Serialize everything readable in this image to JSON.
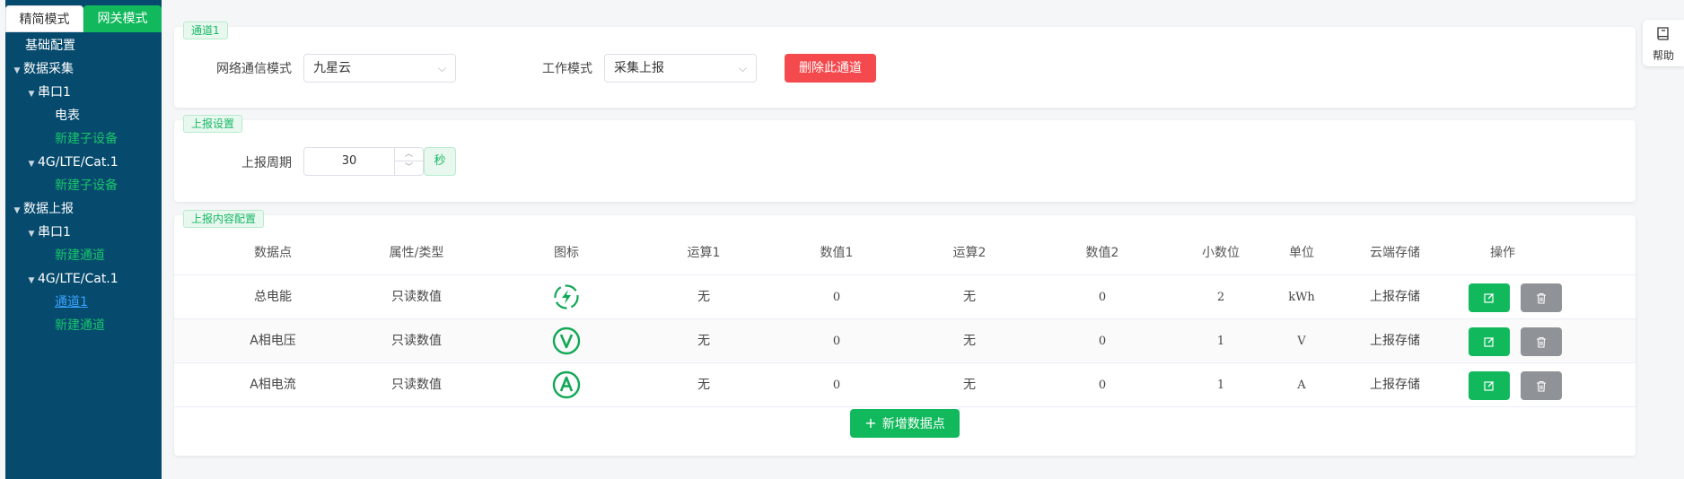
{
  "mode_tabs": {
    "simple": "精简模式",
    "gateway": "网关模式"
  },
  "tree": {
    "basic_config": "基础配置",
    "data_collect": "数据采集",
    "serial1_a": "串口1",
    "meter": "电表",
    "new_sub_device_1": "新建子设备",
    "lte_a": "4G/LTE/Cat.1",
    "new_sub_device_2": "新建子设备",
    "data_report": "数据上报",
    "serial1_b": "串口1",
    "new_channel_1": "新建通道",
    "lte_b": "4G/LTE/Cat.1",
    "channel1": "通道1",
    "new_channel_2": "新建通道"
  },
  "channel_card": {
    "tag": "通道1",
    "network_mode_label": "网络通信模式",
    "network_mode_value": "九星云",
    "work_mode_label": "工作模式",
    "work_mode_value": "采集上报",
    "delete_label": "删除此通道"
  },
  "report_card": {
    "tag": "上报设置",
    "period_label": "上报周期",
    "period_value": "30",
    "period_unit": "秒"
  },
  "content_card": {
    "tag": "上报内容配置",
    "headers": {
      "point": "数据点",
      "type": "属性/类型",
      "icon": "图标",
      "op1": "运算1",
      "val1": "数值1",
      "op2": "运算2",
      "val2": "数值2",
      "decimals": "小数位",
      "unit": "单位",
      "cloud": "云端存储",
      "action": "操作"
    },
    "rows": [
      {
        "point": "总电能",
        "type": "只读数值",
        "icon": "energy-bolt-icon",
        "op1": "无",
        "val1": "0",
        "op2": "无",
        "val2": "0",
        "decimals": "2",
        "unit": "kWh",
        "cloud": "上报存储"
      },
      {
        "point": "A相电压",
        "type": "只读数值",
        "icon": "voltage-v-icon",
        "op1": "无",
        "val1": "0",
        "op2": "无",
        "val2": "0",
        "decimals": "1",
        "unit": "V",
        "cloud": "上报存储"
      },
      {
        "point": "A相电流",
        "type": "只读数值",
        "icon": "current-a-icon",
        "op1": "无",
        "val1": "0",
        "op2": "无",
        "val2": "0",
        "decimals": "1",
        "unit": "A",
        "cloud": "上报存储"
      }
    ],
    "add_label": "新增数据点"
  },
  "help": {
    "label": "帮助"
  },
  "colors": {
    "sidebar": "#064a6e",
    "accent": "#11b95c",
    "danger": "#f4494d",
    "gray": "#8f9398"
  }
}
